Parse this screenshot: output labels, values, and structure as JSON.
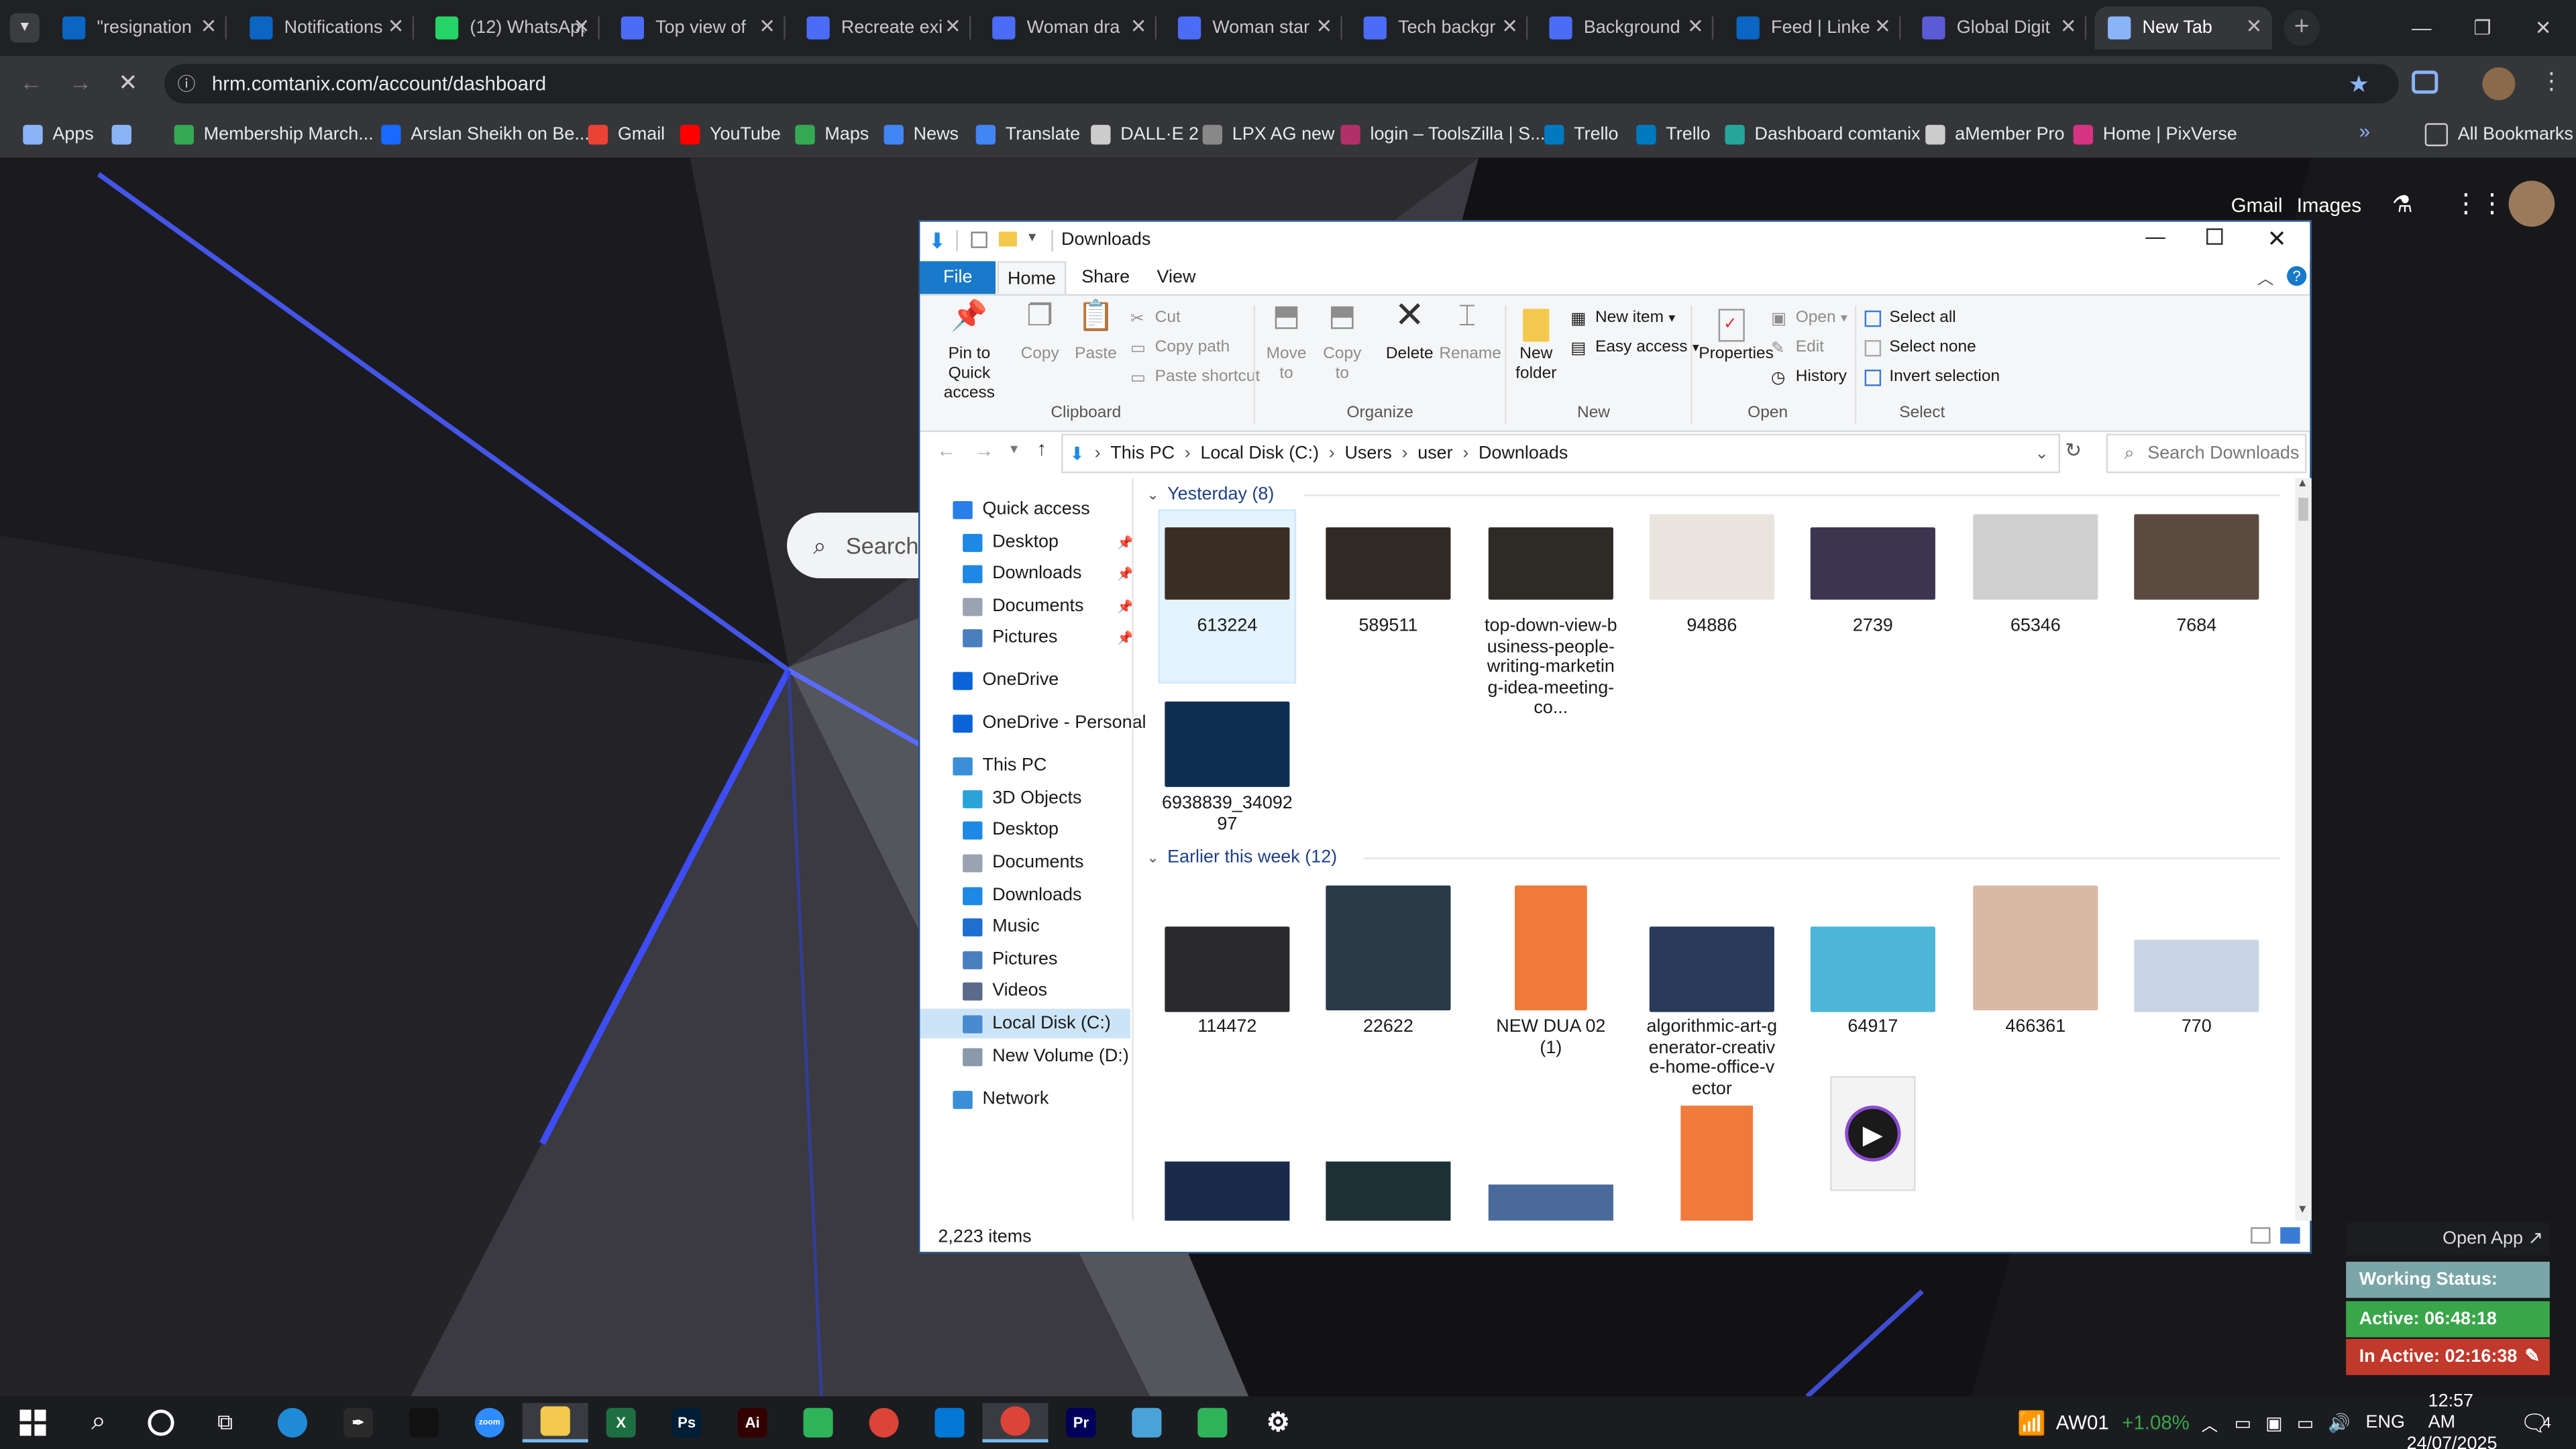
{
  "browser": {
    "tabs": [
      {
        "label": "\"resignation",
        "icon": "linkedin-icon",
        "color": "#0a66c2"
      },
      {
        "label": "Notifications",
        "icon": "linkedin-icon",
        "color": "#0a66c2"
      },
      {
        "label": "(12) WhatsApp",
        "icon": "whatsapp-icon",
        "color": "#25d366"
      },
      {
        "label": "Top view of",
        "icon": "doc-icon",
        "color": "#4a6cf7"
      },
      {
        "label": "Recreate exi",
        "icon": "doc-icon",
        "color": "#4a6cf7"
      },
      {
        "label": "Woman dra",
        "icon": "doc-icon",
        "color": "#4a6cf7"
      },
      {
        "label": "Woman star",
        "icon": "doc-icon",
        "color": "#4a6cf7"
      },
      {
        "label": "Tech backgr",
        "icon": "doc-icon",
        "color": "#4a6cf7"
      },
      {
        "label": "Background",
        "icon": "doc-icon",
        "color": "#4a6cf7"
      },
      {
        "label": "Feed | Linke",
        "icon": "linkedin-icon",
        "color": "#0a66c2"
      },
      {
        "label": "Global Digit",
        "icon": "x-icon",
        "color": "#5b5bd6"
      },
      {
        "label": "New Tab",
        "icon": "loading-icon",
        "color": "#8ab4f8"
      }
    ],
    "url": "hrm.comtanix.com/account/dashboard",
    "bookmarks": [
      {
        "label": "Apps",
        "color": "#8ab4f8"
      },
      {
        "label": "",
        "color": "#8ab4f8"
      },
      {
        "label": "Membership March...",
        "color": "#34a853"
      },
      {
        "label": "Arslan Sheikh on Be...",
        "color": "#1769ff"
      },
      {
        "label": "Gmail",
        "color": "#ea4335"
      },
      {
        "label": "YouTube",
        "color": "#ff0000"
      },
      {
        "label": "Maps",
        "color": "#34a853"
      },
      {
        "label": "News",
        "color": "#4285f4"
      },
      {
        "label": "Translate",
        "color": "#4285f4"
      },
      {
        "label": "DALL·E 2",
        "color": "#cccccc"
      },
      {
        "label": "LPX AG new",
        "color": "#888888"
      },
      {
        "label": "login – ToolsZilla | S...",
        "color": "#b0306a"
      },
      {
        "label": "Trello",
        "color": "#0079bf"
      },
      {
        "label": "Trello",
        "color": "#0079bf"
      },
      {
        "label": "Dashboard comtanix",
        "color": "#26a69a"
      },
      {
        "label": "aMember Pro",
        "color": "#cccccc"
      },
      {
        "label": "Home | PixVerse",
        "color": "#d63384"
      }
    ],
    "all_bookmarks": "All Bookmarks",
    "google_links": {
      "gmail": "Gmail",
      "images": "Images"
    },
    "search_placeholder": "Search"
  },
  "explorer": {
    "title": "Downloads",
    "ribbon_tabs": [
      "File",
      "Home",
      "Share",
      "View"
    ],
    "ribbon": {
      "pin": "Pin to Quick access",
      "copy": "Copy",
      "paste": "Paste",
      "cut": "Cut",
      "copy_path": "Copy path",
      "paste_shortcut": "Paste shortcut",
      "clipboard": "Clipboard",
      "move_to": "Move to",
      "copy_to": "Copy to",
      "delete": "Delete",
      "rename": "Rename",
      "organize": "Organize",
      "new_folder": "New folder",
      "new_item": "New item",
      "easy_access": "Easy access",
      "new": "New",
      "properties": "Properties",
      "open": "Open",
      "edit": "Edit",
      "history": "History",
      "open_group": "Open",
      "select_all": "Select all",
      "select_none": "Select none",
      "invert_selection": "Invert selection",
      "select": "Select"
    },
    "path": [
      "This PC",
      "Local Disk (C:)",
      "Users",
      "user",
      "Downloads"
    ],
    "search_placeholder": "Search Downloads",
    "nav": [
      {
        "label": "Quick access",
        "icon": "star-icon",
        "color": "#2b7de9",
        "indent": 0
      },
      {
        "label": "Desktop",
        "icon": "desktop-icon",
        "color": "#1e88e5",
        "indent": 1,
        "pinned": true
      },
      {
        "label": "Downloads",
        "icon": "download-icon",
        "color": "#1e88e5",
        "indent": 1,
        "pinned": true
      },
      {
        "label": "Documents",
        "icon": "documents-icon",
        "color": "#9aa4b0",
        "indent": 1,
        "pinned": true
      },
      {
        "label": "Pictures",
        "icon": "pictures-icon",
        "color": "#4a7fbf",
        "indent": 1,
        "pinned": true
      },
      {
        "label": "OneDrive",
        "icon": "cloud-icon",
        "color": "#0a64d8",
        "indent": 0
      },
      {
        "label": "OneDrive - Personal",
        "icon": "cloud-icon",
        "color": "#0a64d8",
        "indent": 0
      },
      {
        "label": "This PC",
        "icon": "pc-icon",
        "color": "#3a8fd8",
        "indent": 0
      },
      {
        "label": "3D Objects",
        "icon": "cube-icon",
        "color": "#29a3d8",
        "indent": 1
      },
      {
        "label": "Desktop",
        "icon": "desktop-icon",
        "color": "#1e88e5",
        "indent": 1
      },
      {
        "label": "Documents",
        "icon": "documents-icon",
        "color": "#9aa4b0",
        "indent": 1
      },
      {
        "label": "Downloads",
        "icon": "download-icon",
        "color": "#1e88e5",
        "indent": 1
      },
      {
        "label": "Music",
        "icon": "music-icon",
        "color": "#1e6fd0",
        "indent": 1
      },
      {
        "label": "Pictures",
        "icon": "pictures-icon",
        "color": "#4a7fbf",
        "indent": 1
      },
      {
        "label": "Videos",
        "icon": "videos-icon",
        "color": "#5a6a8a",
        "indent": 1
      },
      {
        "label": "Local Disk (C:)",
        "icon": "disk-icon",
        "color": "#4a8ad0",
        "indent": 1,
        "selected": true
      },
      {
        "label": "New Volume (D:)",
        "icon": "disk-icon",
        "color": "#8a9aaa",
        "indent": 1
      },
      {
        "label": "Network",
        "icon": "network-icon",
        "color": "#3a8fd8",
        "indent": 0
      }
    ],
    "groups": [
      {
        "label": "Yesterday (8)"
      },
      {
        "label": "Earlier this week (12)"
      }
    ],
    "yesterday_files": [
      {
        "name": "613224",
        "color": "#3a2e24",
        "selected": true
      },
      {
        "name": "589511",
        "color": "#2f2a24"
      },
      {
        "name": "top-down-view-business-people-writing-marketing-idea-meeting-co...",
        "color": "#2e2a25"
      },
      {
        "name": "94886",
        "color": "#e9e4dd"
      },
      {
        "name": "2739",
        "color": "#3b3550"
      },
      {
        "name": "65346",
        "color": "#cfcfcf"
      },
      {
        "name": "7684",
        "color": "#5a4a40"
      },
      {
        "name": "6938839_3409297",
        "color": "#0f2f52"
      }
    ],
    "week_files": [
      {
        "name": "114472",
        "color": "#2a2a2e"
      },
      {
        "name": "22622",
        "color": "#2a3a46"
      },
      {
        "name": "NEW DUA 02 (1)",
        "color": "#f07a3a"
      },
      {
        "name": "algorithmic-art-generator-creative-home-office-vector",
        "color": "#2a3a5a"
      },
      {
        "name": "64917",
        "color": "#4cb5d8"
      },
      {
        "name": "466361",
        "color": "#d9b9a5"
      },
      {
        "name": "770",
        "color": "#c9d5e5"
      }
    ],
    "item_count": "2,223 items"
  },
  "widget": {
    "open_app": "Open App ↗",
    "working_status": "Working Status: Active",
    "active": "Active: 06:48:18",
    "inactive": "In Active: 02:16:38"
  },
  "taskbar": {
    "stock_name": "AW01",
    "stock_change": "+1.08%",
    "language": "ENG",
    "time": "12:57 AM",
    "date": "24/07/2025",
    "notifications": "4"
  }
}
